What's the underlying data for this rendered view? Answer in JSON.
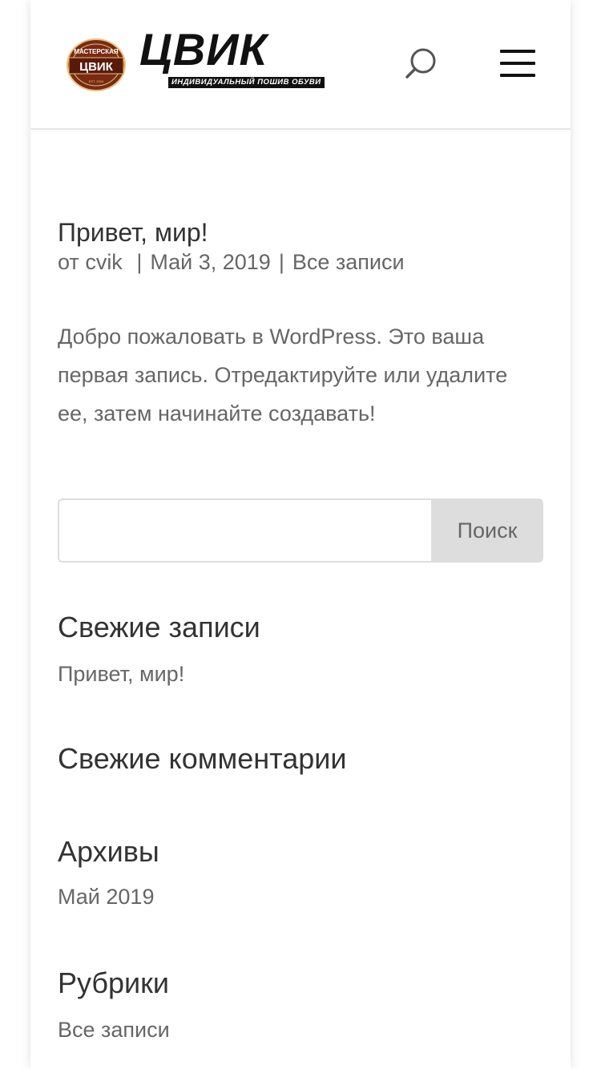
{
  "header": {
    "logo": {
      "badge_top": "МАСТЕРСКАЯ",
      "badge_main": "ЦВИК",
      "badge_bottom": "EST. 2004",
      "wordmark": "ЦВИК",
      "tagline": "ИНДИВИДУАЛЬНЫЙ ПОШИВ ОБУВИ"
    },
    "search_icon": "search-icon",
    "menu_icon": "hamburger-menu-icon"
  },
  "post": {
    "title": "Привет, мир!",
    "meta": {
      "by": "от",
      "author": "cvik",
      "separator": "|",
      "date": "Май 3, 2019",
      "category": "Все записи"
    },
    "body": "Добро пожаловать в WordPress. Это ваша первая запись. Отредактируйте или удалите ее, затем начинайте создавать!"
  },
  "search": {
    "value": "",
    "placeholder": "",
    "button_label": "Поиск"
  },
  "widgets": {
    "recent_posts": {
      "title": "Свежие записи",
      "items": [
        "Привет, мир!"
      ]
    },
    "recent_comments": {
      "title": "Свежие комментарии",
      "items": []
    },
    "archives": {
      "title": "Архивы",
      "items": [
        "Май 2019"
      ]
    },
    "categories": {
      "title": "Рубрики",
      "items": [
        "Все записи"
      ]
    }
  },
  "colors": {
    "text_dark": "#333333",
    "text_muted": "#666666",
    "button_bg": "#dddddd",
    "logo_brown": "#7a2a12",
    "logo_gold": "#e8c27a"
  }
}
